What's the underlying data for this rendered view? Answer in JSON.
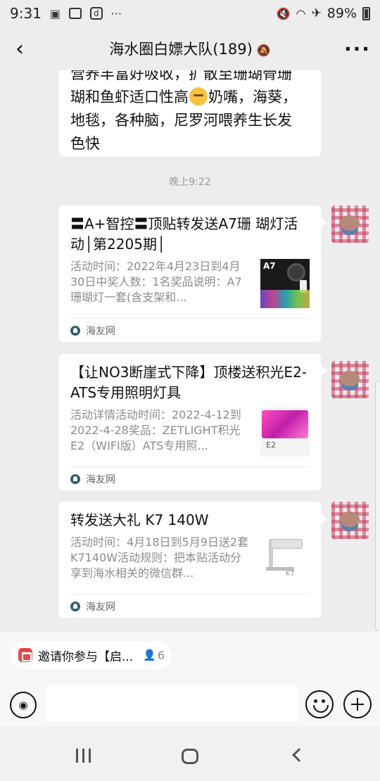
{
  "status_bar": {
    "time": "9:31",
    "battery": "89%",
    "icons_left": [
      "gallery-icon",
      "box-icon",
      "d-app-icon",
      "more-dots-icon"
    ],
    "icons_right": [
      "mute-vibrate-icon",
      "wifi-icon",
      "airplane-icon",
      "battery-icon"
    ]
  },
  "nav": {
    "title": "海水圈白嫖大队(189)",
    "back_icon": "chevron-left-icon",
    "more_label": "···"
  },
  "chat": {
    "top_bubble_lines": [
      "营养丰富好吸收，扩散至珊瑚骨珊",
      "瑚和鱼虾适口性高",
      "奶嘴，海葵，",
      "地毯，各种脑，尼罗河喂养生长发",
      "色快"
    ],
    "timestamp": "晚上9:22",
    "cards": [
      {
        "title": "〓A+智控〓顶贴转发送A7珊 瑚灯活动│第2205期│",
        "desc": "活动时间：2022年4月23日到4月30日中奖人数：1名奖品说明：A7珊瑚灯一套(含支架和...",
        "thumb_label": "A7",
        "source": "海友网"
      },
      {
        "title": "【让NO3断崖式下降】顶楼送积光E2-ATS专用照明灯具",
        "desc": "活动详情活动时间：2022-4-12到2022-4-28奖品：ZETLIGHT积光E2（WIFI版）ATS专用照...",
        "thumb_label": "E2",
        "source": "海友网"
      },
      {
        "title": "转发送大礼 K7 140W",
        "desc": "活动时间：4月18日到5月9日送2套K7140W活动规则：把本贴活动分享到海水相关的微信群...",
        "thumb_label": "K7",
        "source": "海友网"
      }
    ]
  },
  "bottom": {
    "chip_text": "邀请你参与【启...",
    "chip_count": "6",
    "input_placeholder": ""
  },
  "colors": {
    "background": "#ededed",
    "bubble": "#ffffff",
    "muted_text": "#8c8c8c"
  }
}
